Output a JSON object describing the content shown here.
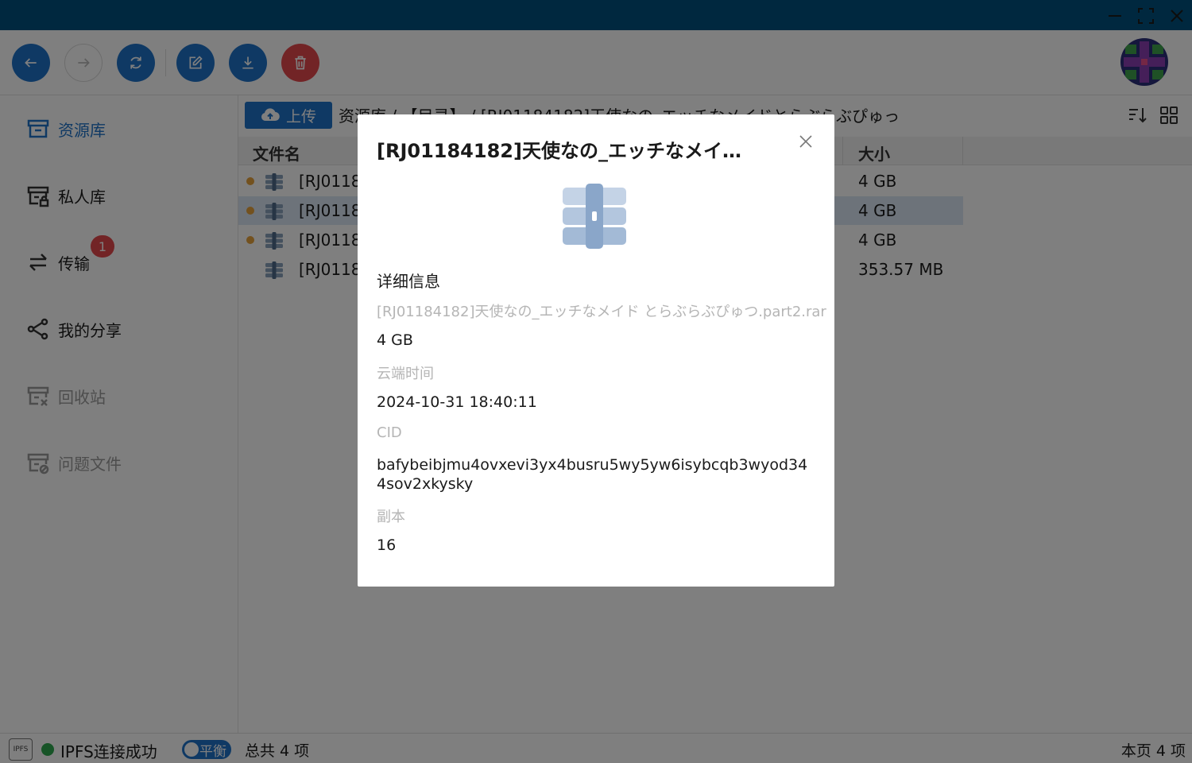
{
  "window": {
    "controls": [
      "minimize-icon",
      "maximize-icon",
      "close-icon"
    ]
  },
  "toolbar": {
    "buttons": [
      "back-arrow-icon",
      "forward-arrow-icon",
      "refresh-icon",
      "edit-icon",
      "download-icon",
      "delete-icon"
    ]
  },
  "sidebar": {
    "items": [
      {
        "label": "资源库",
        "icon": "library-icon",
        "state": "active"
      },
      {
        "label": "私人库",
        "icon": "private-library-icon",
        "state": "normal"
      },
      {
        "label": "传输",
        "icon": "transfer-icon",
        "state": "normal",
        "badge": "1"
      },
      {
        "label": "我的分享",
        "icon": "share-icon",
        "state": "normal"
      },
      {
        "label": "回收站",
        "icon": "recycle-bin-icon",
        "state": "disabled"
      },
      {
        "label": "问题文件",
        "icon": "problem-files-icon",
        "state": "disabled"
      }
    ]
  },
  "content": {
    "upload_label": "上传",
    "breadcrumb": "资源库 / 【目录】 / [RJ01184182]天使なの_エッチなメイドとらぶらぶぴゅっ",
    "columns": {
      "name": "文件名",
      "size": "大小"
    },
    "rows": [
      {
        "name": "[RJ0118",
        "size": "4 GB",
        "status_dot": true,
        "selected": false
      },
      {
        "name": "[RJ0118",
        "size": "4 GB",
        "status_dot": true,
        "selected": true
      },
      {
        "name": "[RJ0118",
        "size": "4 GB",
        "status_dot": true,
        "selected": false
      },
      {
        "name": "[RJ0118",
        "size": "353.57 MB",
        "status_dot": false,
        "selected": false
      }
    ]
  },
  "statusbar": {
    "logo_text": "IPFS",
    "connection": "IPFS连接成功",
    "mode": "平衡",
    "total": "总共 4 项",
    "page_count": "本页 4 项"
  },
  "modal": {
    "title": "[RJ01184182]天使なの_エッチなメイド...",
    "heading": "详细信息",
    "filename": "[RJ01184182]天使なの_エッチなメイド とらぶらぶぴゅつ.part2.rar",
    "size": "4 GB",
    "time_label": "云端时间",
    "time_value": "2024-10-31 18:40:11",
    "cid_label": "CID",
    "cid_value": "bafybeibjmu4ovxevi3yx4busru5wy5yw6isybcqb3wyod344sov2xkysky",
    "replica_label": "副本",
    "replica_value": "16"
  },
  "colors": {
    "titlebar": "#00507f",
    "accent": "#1e73c8",
    "danger": "#e5484d",
    "status_ok": "#2fa84f",
    "pending_dot": "#e6a23c"
  }
}
